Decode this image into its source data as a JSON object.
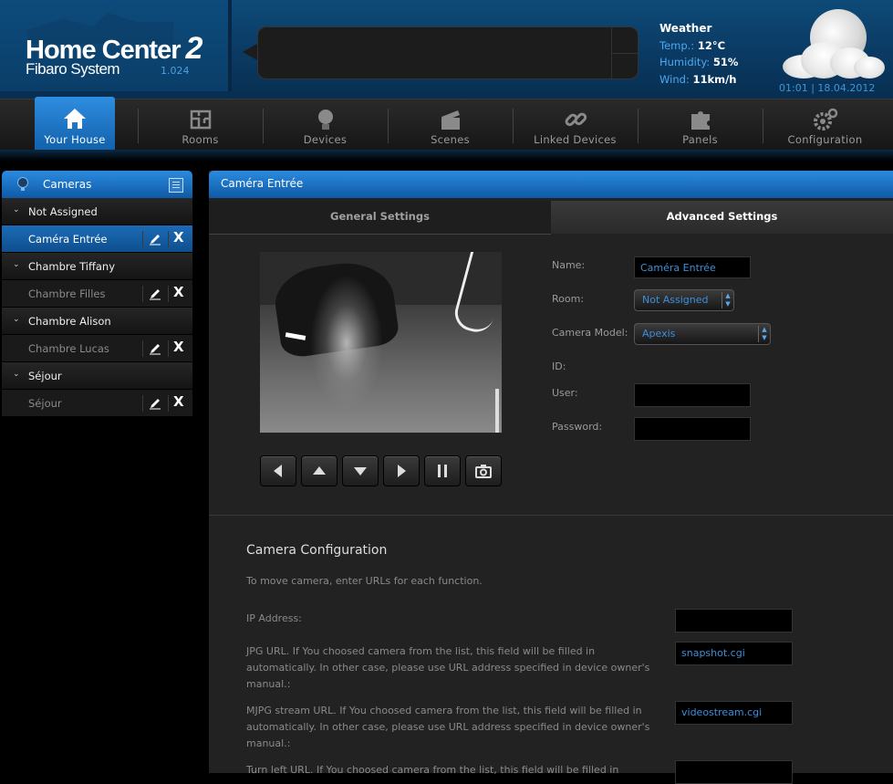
{
  "header": {
    "brand_title": "Home Center",
    "brand_number": "2",
    "brand_subtitle": "Fibaro System",
    "version": "1.024",
    "weather": {
      "title": "Weather",
      "temp_label": "Temp.:",
      "temp_value": "12°C",
      "humidity_label": "Humidity:",
      "humidity_value": "51%",
      "wind_label": "Wind:",
      "wind_value": "11km/h"
    },
    "datetime": "01:01 | 18.04.2012"
  },
  "nav": {
    "items": [
      {
        "label": "Your House",
        "icon": "house-icon"
      },
      {
        "label": "Rooms",
        "icon": "rooms-icon"
      },
      {
        "label": "Devices",
        "icon": "bulb-icon"
      },
      {
        "label": "Scenes",
        "icon": "clapperboard-icon"
      },
      {
        "label": "Linked Devices",
        "icon": "link-icon"
      },
      {
        "label": "Panels",
        "icon": "puzzle-icon"
      },
      {
        "label": "Configuration",
        "icon": "gears-icon"
      }
    ],
    "active": "Your House"
  },
  "sidebar": {
    "title": "Cameras",
    "groups": [
      {
        "label": "Not Assigned",
        "items": [
          {
            "label": "Caméra Entrée",
            "selected": true
          }
        ]
      },
      {
        "label": "Chambre Tiffany",
        "items": [
          {
            "label": "Chambre Filles"
          }
        ]
      },
      {
        "label": "Chambre Alison",
        "items": [
          {
            "label": "Chambre Lucas"
          }
        ]
      },
      {
        "label": "Séjour",
        "items": [
          {
            "label": "Séjour"
          }
        ]
      }
    ],
    "delete_glyph": "X"
  },
  "panel": {
    "title": "Caméra Entrée",
    "tabs": {
      "general": "General Settings",
      "advanced": "Advanced Settings"
    },
    "form": {
      "name_label": "Name:",
      "name_value": "Caméra Entrée",
      "room_label": "Room:",
      "room_value": "Not Assigned",
      "model_label": "Camera Model:",
      "model_value": "Apexis",
      "id_label": "ID:",
      "user_label": "User:",
      "user_value": "",
      "password_label": "Password:",
      "password_value": ""
    },
    "config": {
      "title": "Camera Configuration",
      "description": "To move camera, enter URLs for each function.",
      "ip_label": "IP Address:",
      "ip_value": "",
      "jpg_label": "JPG URL. If You choosed camera from the list, this field will be filled in automatically. In other case, please use URL address specified in device owner's manual.:",
      "jpg_value": "snapshot.cgi",
      "mjpg_label": "MJPG stream URL. If You choosed camera from the list, this field will be filled in automatically. In other case, please use URL address specified in device owner's manual.:",
      "mjpg_value": "videostream.cgi",
      "left_label": "Turn left URL. If You choosed camera from the list, this field will be filled in",
      "left_value": ""
    }
  },
  "colors": {
    "accent": "#1c78c8",
    "link_text": "#3c8fd8",
    "weather_label": "#4da9ef"
  }
}
